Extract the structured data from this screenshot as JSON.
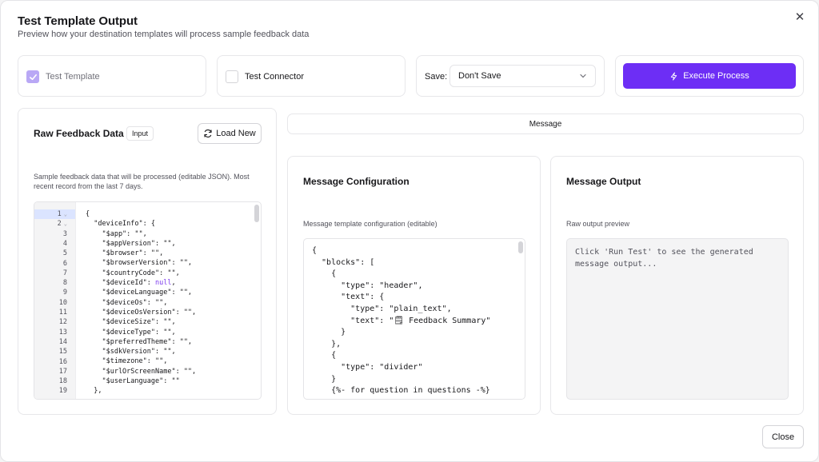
{
  "modal": {
    "title": "Test Template Output",
    "subtitle": "Preview how your destination templates will process sample feedback data",
    "close_icon": "close-icon"
  },
  "options": {
    "test_template": {
      "label": "Test Template",
      "checked": true
    },
    "test_connector": {
      "label": "Test Connector",
      "checked": false
    },
    "save": {
      "label": "Save:",
      "selected": "Don't Save"
    },
    "execute": {
      "label": "Execute Process",
      "icon": "lightning-icon"
    }
  },
  "raw": {
    "title": "Raw Feedback Data",
    "badge": "Input",
    "load_label": "Load New",
    "description": "Sample feedback data that will be processed (editable JSON). Most recent record from the last 7 days.",
    "line_numbers": [
      "1",
      "2",
      "3",
      "4",
      "5",
      "6",
      "7",
      "8",
      "9",
      "10",
      "11",
      "12",
      "13",
      "14",
      "15",
      "16",
      "17",
      "18",
      "19"
    ],
    "code": [
      "{",
      "  \"deviceInfo\": {",
      "    \"$app\": \"\",",
      "    \"$appVersion\": \"\",",
      "    \"$browser\": \"\",",
      "    \"$browserVersion\": \"\",",
      "    \"$countryCode\": \"\",",
      "    \"$deviceId\": null,",
      "    \"$deviceLanguage\": \"\",",
      "    \"$deviceOs\": \"\",",
      "    \"$deviceOsVersion\": \"\",",
      "    \"$deviceSize\": \"\",",
      "    \"$deviceType\": \"\",",
      "    \"$preferredTheme\": \"\",",
      "    \"$sdkVersion\": \"\",",
      "    \"$timezone\": \"\",",
      "    \"$urlOrScreenName\": \"\",",
      "    \"$userLanguage\": \"\"",
      "  },"
    ]
  },
  "tab": {
    "label": "Message"
  },
  "config": {
    "title": "Message Configuration",
    "description": "Message template configuration (editable)",
    "code": [
      "{",
      "  \"blocks\": [",
      "    {",
      "      \"type\": \"header\",",
      "      \"text\": {",
      "        \"type\": \"plain_text\",",
      "        \"text\": \"🗒 Feedback Summary\"",
      "      }",
      "    },",
      "    {",
      "      \"type\": \"divider\"",
      "    }",
      "    {%- for question in questions -%}"
    ]
  },
  "output": {
    "title": "Message Output",
    "description": "Raw output preview",
    "placeholder": "Click 'Run Test' to see the generated message output..."
  },
  "footer": {
    "close_label": "Close"
  },
  "colors": {
    "accent": "#6d2ef5",
    "checkbox_checked": "#b9a8f5"
  }
}
